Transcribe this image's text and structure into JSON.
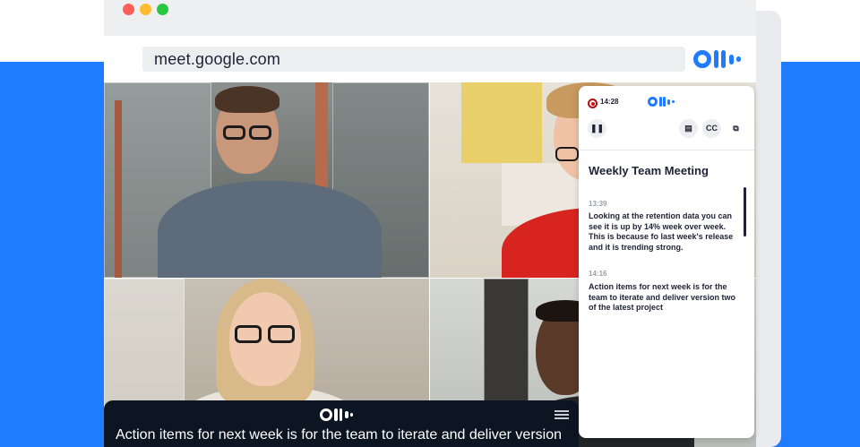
{
  "browser": {
    "url": "meet.google.com"
  },
  "caption_bar": {
    "text": "Action items for next week is for the team to iterate and deliver version"
  },
  "panel": {
    "recording_time": "14:28",
    "meeting_title": "Weekly Team Meeting",
    "segments": [
      {
        "time": "13:39",
        "text": "Looking at the retention data you can see it is up by 14% week over week. This is because fo last week's release and it is trending strong."
      },
      {
        "time": "14:16",
        "text": "Action items for next week is for the team to iterate and deliver version two of the latest project"
      }
    ],
    "icons": [
      "record-icon",
      "pause-icon",
      "notes-icon",
      "closed-captions-icon",
      "open-external-icon"
    ]
  },
  "colors": {
    "brand_blue": "#1f7bff",
    "caption_bg": "#0c1622",
    "record_red": "#d11217"
  }
}
